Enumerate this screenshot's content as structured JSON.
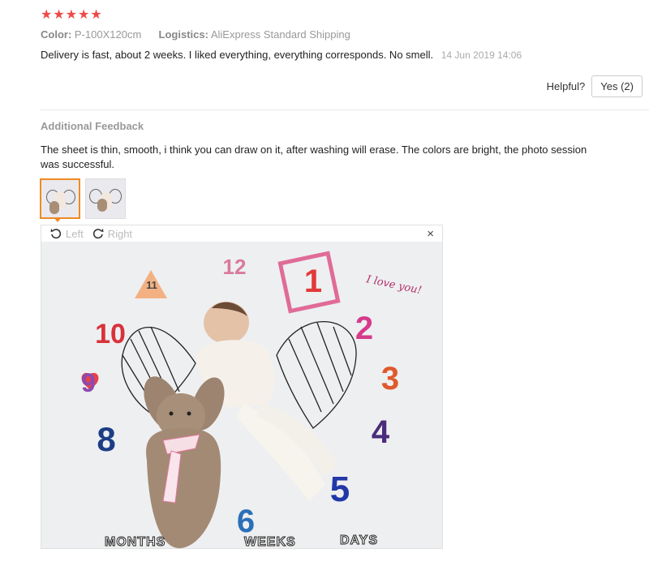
{
  "review": {
    "rating": 5,
    "color_label": "Color:",
    "color_value": "P-100X120cm",
    "logistics_label": "Logistics:",
    "logistics_value": "AliExpress Standard Shipping",
    "text": "Delivery is fast, about 2 weeks. I liked everything, everything corresponds. No smell.",
    "date": "14 Jun 2019 14:06",
    "helpful_label": "Helpful?",
    "yes_label": "Yes (2)"
  },
  "additional": {
    "title": "Additional Feedback",
    "text": "The sheet is thin, smooth, i think you can draw on it, after washing will erase. The colors are bright, the photo session was successful."
  },
  "viewer": {
    "left_label": "Left",
    "right_label": "Right",
    "close_symbol": "×",
    "photo_texts": {
      "n11": "11",
      "n12": "12",
      "n10": "10",
      "n9": "9",
      "n8": "8",
      "n6": "6",
      "n5": "5",
      "n4": "4",
      "n3": "3",
      "n2": "2",
      "n1": "1",
      "love": "I love you!",
      "months": "MONTHS",
      "weeks": "WEEKS",
      "days": "DAYS"
    }
  },
  "colors": {
    "star": "#f04848",
    "accent": "#f08a24"
  }
}
